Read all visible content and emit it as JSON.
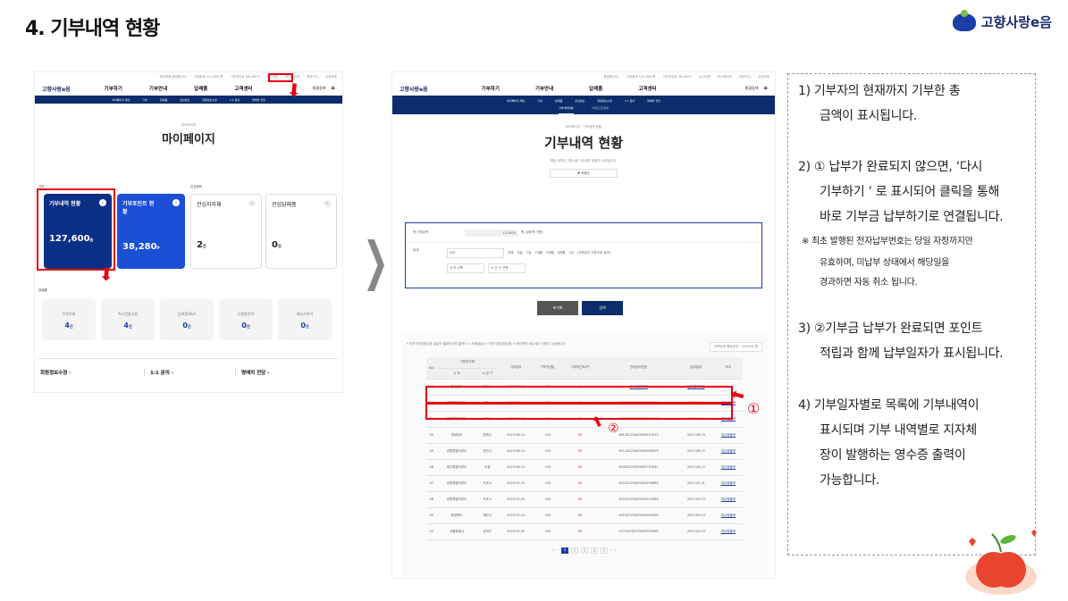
{
  "slide": {
    "title": "4. 기부내역 현황",
    "brand": "고향사랑e음"
  },
  "left": {
    "topbar": [
      "정보포함 환영합니다",
      "기부합계 127,600 원",
      "기부포인트 38,280 P",
      "로그아웃",
      "마이페이지",
      "장바구니",
      "주문조회"
    ],
    "nav_logo": "고향사랑e음",
    "nav": [
      "기부하기",
      "기부안내",
      "답례품",
      "고객센터"
    ],
    "nav_search": "통합검색",
    "subnav": [
      "마이페이지 메인",
      "기부",
      "답례품",
      "관심정보",
      "회원정보수정",
      "1:1 문의",
      "명예의 전당"
    ],
    "breadcrumb": "마이페이지",
    "heading": "마이페이지",
    "sec_donation": "기부",
    "sec_interest": "관심정보",
    "card1": {
      "label": "기부내역 현황",
      "value": "127,600",
      "unit": "원"
    },
    "card2": {
      "label": "기부포인트 현황",
      "value": "38,280",
      "unit": "P"
    },
    "card3": {
      "label": "관심지자체",
      "value": "2",
      "unit": "건"
    },
    "card4": {
      "label": "관심답례품",
      "value": "0",
      "unit": "건"
    },
    "sec_gift": "답례품",
    "stats": [
      {
        "label": "주문조회",
        "value": "4",
        "unit": "건"
      },
      {
        "label": "취소반품교환",
        "value": "4",
        "unit": "건"
      },
      {
        "label": "답례품Q&A",
        "value": "0",
        "unit": "건"
      },
      {
        "label": "답례품문의",
        "value": "0",
        "unit": "건"
      },
      {
        "label": "배송지관리",
        "value": "0",
        "unit": "건"
      }
    ],
    "links": [
      "회원정보수정",
      "1:1 문의",
      "명예의 전당"
    ]
  },
  "right": {
    "topbar": [
      "환영합니다.",
      "기부합계 127,600 원",
      "기부포인트 38,280 P",
      "로그아웃",
      "마이페이지",
      "장바구니",
      "주문조회"
    ],
    "nav_logo": "고향사랑e음",
    "nav": [
      "기부하기",
      "기부안내",
      "답례품",
      "고객센터"
    ],
    "nav_search": "통합검색",
    "subnav": [
      "마이페이지 메인",
      "기부",
      "답례품",
      "관심정보",
      "회원정보수정",
      "1:1 문의",
      "명예의 전당"
    ],
    "subtabs": [
      "기부내역현황",
      "기부포인트현황"
    ],
    "breadcrumb": "마이페이지 · 기부내역 현황",
    "heading": "기부내역 현황",
    "desc": "해당 내역은 고향사랑 기부제만 현황만 나타냅니다.",
    "toggle_label": "목록닫",
    "filter_total_label": "총 기부금액",
    "filter_total_value": "127,600",
    "filter_total_note": "원 (납부액 기준)",
    "filter_search_label": "검색",
    "filter_year": "년도",
    "filter_periods": [
      "전체",
      "오늘",
      "7일",
      "1개월",
      "3개월",
      "6개월",
      "1년"
    ],
    "filter_period_note": "(기부일자 기준으로 검색)",
    "filter_sido": "시·도 선택",
    "filter_sigungu": "시·군·구 선택",
    "btn_reset": "초기화",
    "btn_search": "검색",
    "notice": "* 전자기부금영수증 발급이 필요하시면 홈택스 > 조회/발급 > 전자기부금영수증 > 메인화면 메뉴에서 신청이 가능합니다.",
    "tax_total": "세액공제 예상금액 : 104,554 원",
    "table_headers": [
      "No.",
      "기부지자체",
      "시·도",
      "시·군·구",
      "기부일자",
      "기부액(원)",
      "기부포인트(P)",
      "전자납부번호",
      "납부일자",
      "비고"
    ],
    "rows": [
      [
        "53",
        "충청남도",
        "천안시",
        "2023.06.26",
        "100",
        "0",
        "다시 기부하기",
        "납부결과확인",
        ""
      ],
      [
        "52",
        "강원특별자치도",
        "속초시",
        "2023.06.16",
        "100",
        "30",
        "51210223400000164015",
        "2023.06.16",
        "영수증출력"
      ],
      [
        "51",
        "강원특별자치도",
        "속초시",
        "2023.06.16",
        "100",
        "30",
        "51210223400000164248",
        "2023.06.16",
        "영수증출력"
      ],
      [
        "50",
        "경상남도",
        "창원시",
        "2023.06.14",
        "100",
        "30",
        "48120223400000151915",
        "2023.06.14",
        "영수증출력"
      ],
      [
        "49",
        "강원특별자치도",
        "춘천시",
        "2023.06.12",
        "100",
        "30",
        "51110223400000005629",
        "2023.06.12",
        "영수증출력"
      ],
      [
        "48",
        "제주특별자치도",
        "도청",
        "2023.06.12",
        "100",
        "30",
        "50000223300000797541",
        "2023.06.12",
        "영수증출력"
      ],
      [
        "47",
        "강원특별자치도",
        "속초시",
        "2023.05.31",
        "100",
        "30",
        "42210223400000155889",
        "2023.05.31",
        "영수증출력"
      ],
      [
        "46",
        "강원특별자치도",
        "속초시",
        "2023.05.25",
        "100",
        "30",
        "42210223400000147984",
        "2023.05.25",
        "영수증출력"
      ],
      [
        "45",
        "충청북도",
        "제천시",
        "2023.05.24",
        "100",
        "30",
        "43150223400000943490",
        "2023.05.24",
        "영수증출력"
      ],
      [
        "44",
        "서울특별시",
        "송파구",
        "2023.05.09",
        "100",
        "30",
        "11710230230055355560",
        "2023.05.09",
        "영수증출력"
      ]
    ],
    "pages": [
      "1",
      "2",
      "3",
      "4",
      "5"
    ],
    "marker1": "①",
    "marker2": "②"
  },
  "notes": {
    "n1a": "1)  기부자의 현재까지 기부한 총",
    "n1b": "금액이 표시됩니다.",
    "n2a": "2)  ① 납부가 완료되지 않으면, ‘다시",
    "n2b": "기부하기 ’ 로 표시되어 클릭을 통해",
    "n2c": "바로 기부금 납부하기로 연결됩니다.",
    "n2d": "※ 최초 발행된 전자납부번호는 당일 자정까지만",
    "n2e": "유효하며, 미납부 상태에서 해당일을",
    "n2f": "경과하면 자동 취소 됩니다.",
    "n3a": "3)  ②기부금 납부가 완료되면 포인트",
    "n3b": "적립과 함께 납부일자가 표시됩니다.",
    "n4a": "4)  기부일자별로 목록에 기부내역이",
    "n4b": "표시되며 기부 내역별로 지자체",
    "n4c": "장이 발행하는 영수증 출력이",
    "n4d": "가능합니다."
  },
  "colors": {
    "navy": "#0b2d6b",
    "blue": "#1b4fd6",
    "red": "#e60012"
  }
}
